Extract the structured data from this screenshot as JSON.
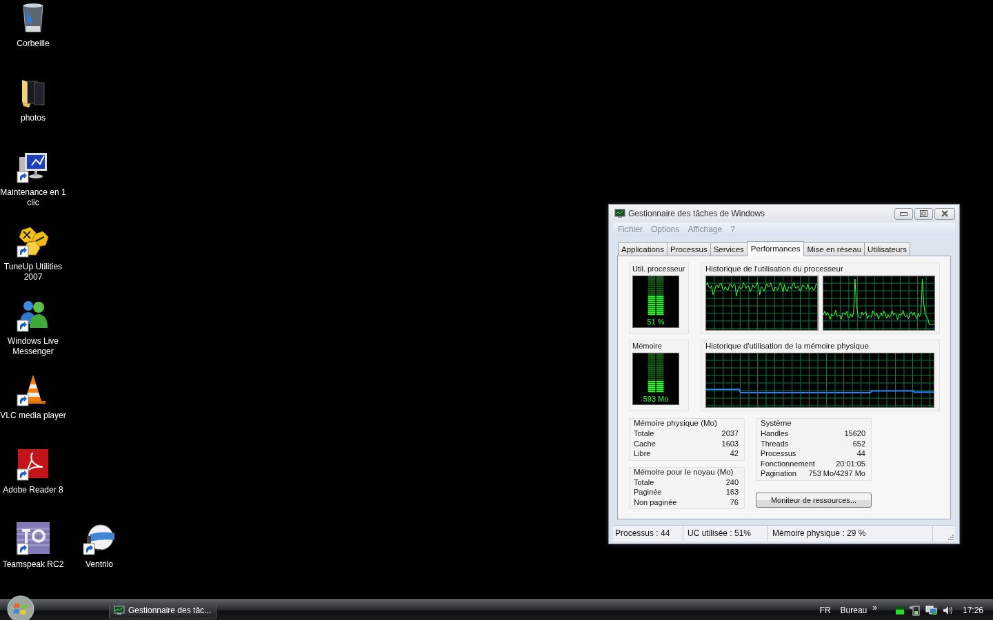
{
  "desktop_icons": [
    {
      "label": "Corbeille",
      "kind": "recycle",
      "shortcut": false
    },
    {
      "label": "photos",
      "kind": "folder",
      "shortcut": false
    },
    {
      "label": "Maintenance en 1 clic",
      "kind": "computer",
      "shortcut": true
    },
    {
      "label": "TuneUp Utilities 2007",
      "kind": "hexagons",
      "shortcut": true
    },
    {
      "label": "Windows Live Messenger",
      "kind": "people",
      "shortcut": true
    },
    {
      "label": "VLC media player",
      "kind": "cone",
      "shortcut": true
    },
    {
      "label": "Adobe Reader 8",
      "kind": "swirl",
      "shortcut": true
    },
    {
      "label": "Teamspeak RC2",
      "kind": "stripes",
      "shortcut": true
    },
    {
      "label": "Ventrilo",
      "kind": "headset",
      "shortcut": true
    }
  ],
  "window": {
    "title": "Gestionnaire des tâches de Windows",
    "menu": [
      "Fichier",
      "Options",
      "Affichage",
      "?"
    ],
    "tabs": [
      {
        "label": "Applications",
        "selected": false
      },
      {
        "label": "Processus",
        "selected": false
      },
      {
        "label": "Services",
        "selected": false
      },
      {
        "label": "Performances",
        "selected": true
      },
      {
        "label": "Mise en réseau",
        "selected": false
      },
      {
        "label": "Utilisateurs",
        "selected": false
      }
    ],
    "performance": {
      "cpu_meter": {
        "title": "Util. processeur",
        "level": 0.51,
        "reading": "51 %"
      },
      "cpu_history": {
        "title": "Historique de l'utilisation du processeur"
      },
      "memory_meter": {
        "title": "Mémoire",
        "level": 0.29,
        "reading": "593 Mo"
      },
      "memory_history": {
        "title": "Historique d'utilisation de la mémoire physique"
      },
      "stat_groups": [
        {
          "title": "Mémoire physique (Mo)",
          "rows": [
            {
              "label": "Totale",
              "value": "2037"
            },
            {
              "label": "Cache",
              "value": "1603"
            },
            {
              "label": "Libre",
              "value": "42"
            }
          ]
        },
        {
          "title": "Mémoire pour le noyau (Mo)",
          "rows": [
            {
              "label": "Totale",
              "value": "240"
            },
            {
              "label": "Paginée",
              "value": "163"
            },
            {
              "label": "Non paginée",
              "value": "76"
            }
          ]
        },
        {
          "title": "Système",
          "rows": [
            {
              "label": "Handles",
              "value": "15620"
            },
            {
              "label": "Threads",
              "value": "652"
            },
            {
              "label": "Processus",
              "value": "44"
            },
            {
              "label": "Fonctionnement",
              "value": "20:01:05"
            },
            {
              "label": "Pagination",
              "value": "753 Mo/4297 Mo"
            }
          ]
        }
      ],
      "resource_monitor_button": "Moniteur de ressources..."
    },
    "status_bar": [
      "Processus : 44",
      "UC utilisée : 51%",
      "Mémoire physique : 29 %"
    ]
  },
  "taskbar": {
    "tasks": [
      {
        "label": "Gestionnaire des tâc...",
        "selected": false
      }
    ],
    "language": "FR",
    "toolbar": "Bureau",
    "chevron": "»",
    "clock": "17:26"
  }
}
